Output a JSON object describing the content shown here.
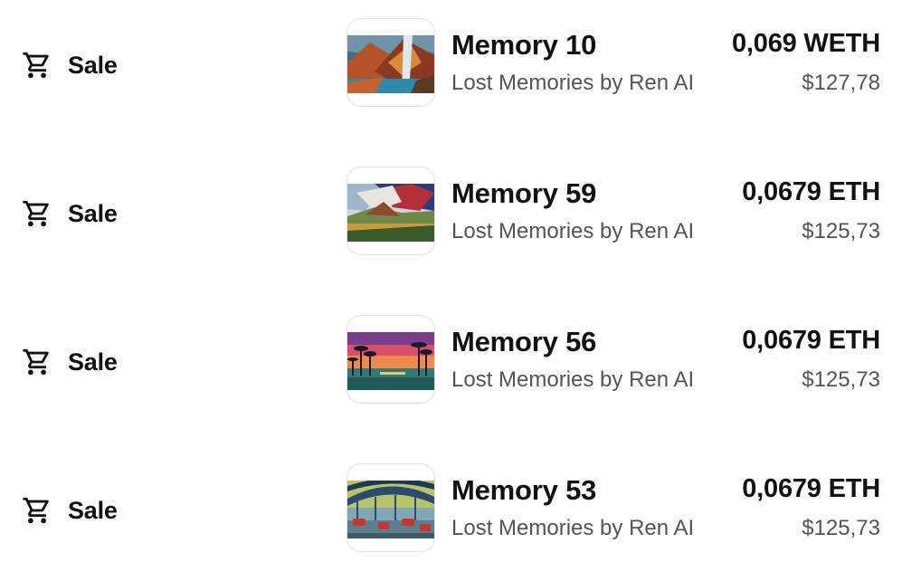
{
  "activity": [
    {
      "event": "Sale",
      "icon": "shopping-cart-icon",
      "name": "Memory 10",
      "collection": "Lost Memories by Ren AI",
      "price": "0,069 WETH",
      "usd": "$127,78"
    },
    {
      "event": "Sale",
      "icon": "shopping-cart-icon",
      "name": "Memory 59",
      "collection": "Lost Memories by Ren AI",
      "price": "0,0679 ETH",
      "usd": "$125,73"
    },
    {
      "event": "Sale",
      "icon": "shopping-cart-icon",
      "name": "Memory 56",
      "collection": "Lost Memories by Ren AI",
      "price": "0,0679 ETH",
      "usd": "$125,73"
    },
    {
      "event": "Sale",
      "icon": "shopping-cart-icon",
      "name": "Memory 53",
      "collection": "Lost Memories by Ren AI",
      "price": "0,0679 ETH",
      "usd": "$125,73"
    }
  ]
}
